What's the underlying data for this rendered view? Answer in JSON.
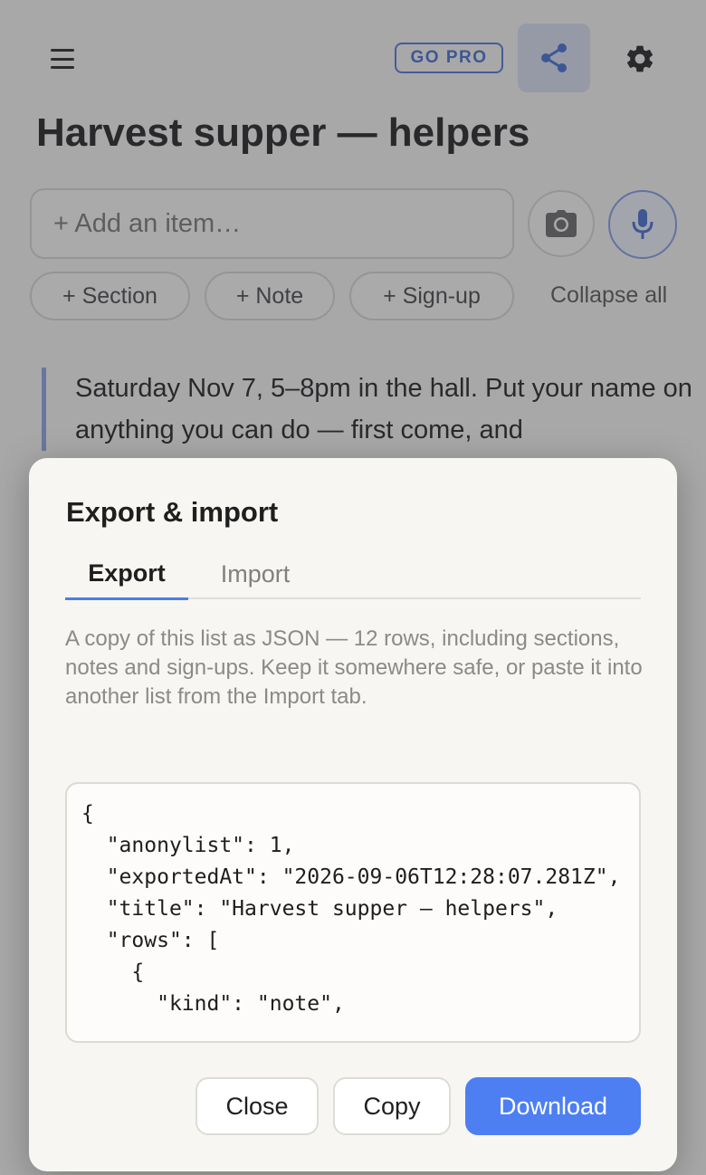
{
  "header": {
    "menu_icon": "hamburger-menu-icon",
    "go_pro_label": "GO PRO",
    "share_icon": "share-icon",
    "settings_icon": "gear-icon"
  },
  "list": {
    "title": "Harvest supper — helpers",
    "add_item_placeholder": "+ Add an item…",
    "camera_icon": "camera-icon",
    "mic_icon": "microphone-icon",
    "chips": {
      "section": "+ Section",
      "note": "+ Note",
      "signup": "+ Sign-up"
    },
    "collapse_all": "Collapse all",
    "note_text": "Saturday Nov 7, 5–8pm in the hall. Put your name on anything you can do — first come, and"
  },
  "modal": {
    "title": "Export & import",
    "tabs": {
      "export": "Export",
      "import": "Import"
    },
    "active_tab": "Export",
    "description": "A copy of this list as JSON — 12 rows, including sections, notes and sign-ups. Keep it somewhere safe, or paste it into another list from the Import tab.",
    "json_text": "{\n  \"anonylist\": 1,\n  \"exportedAt\": \"2026-09-06T12:28:07.281Z\",\n  \"title\": \"Harvest supper — helpers\",\n  \"rows\": [\n    {\n      \"kind\": \"note\",",
    "buttons": {
      "close": "Close",
      "copy": "Copy",
      "download": "Download"
    }
  },
  "colors": {
    "accent": "#4d7ff3",
    "go_pro": "#3f6bd0",
    "note_border": "#8aa3df"
  }
}
